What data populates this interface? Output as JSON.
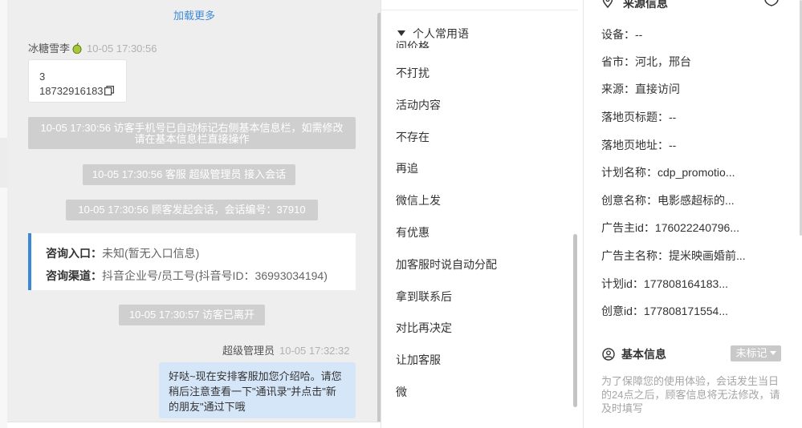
{
  "chat": {
    "load_more": "加载更多",
    "customer": {
      "name": "冰糖雪李",
      "time": "10-05 17:30:56"
    },
    "customer_msg": {
      "line1": "3",
      "line2": "18732916183"
    },
    "sys_messages": [
      "10-05 17:30:56 访客手机号已自动标记右侧基本信息栏，如需修改请在基本信息栏直接操作",
      "10-05 17:30:56 客服 超级管理员 接入会话",
      "10-05 17:30:56 顾客发起会话，会话编号：37910"
    ],
    "consult": {
      "entry_label": "咨询入口：",
      "entry_value": "未知(暂无入口信息)",
      "channel_label": "咨询渠道：",
      "channel_value": "抖音企业号/员工号(抖音号ID：36993034194)"
    },
    "left_msg": "10-05 17:30:57 访客已离开",
    "agent": {
      "name": "超级管理员",
      "time": "10-05 17:32:32"
    },
    "agent_msg": "好哒~现在安排客服加您介绍哈。请您稍后注意查看一下\"通讯录\"并点击\"新的朋友\"通过下哦"
  },
  "phrases": {
    "header": "个人常用语",
    "clipped_item": "问价格",
    "items": [
      "不打扰",
      "活动内容",
      "不存在",
      "再追",
      "微信上发",
      "有优惠",
      "加客服时说自动分配",
      "拿到联系后",
      "对比再决定",
      "让加客服",
      "微"
    ]
  },
  "info": {
    "source_title": "来源信息",
    "fields": [
      {
        "label": "设备：",
        "value": "--"
      },
      {
        "label": "省市：",
        "value": "河北，邢台"
      },
      {
        "label": "来源：",
        "value": "直接访问"
      },
      {
        "label": "落地页标题：",
        "value": "--"
      },
      {
        "label": "落地页地址：",
        "value": "--"
      },
      {
        "label": "计划名称：",
        "value": "cdp_promotio..."
      },
      {
        "label": "创意名称：",
        "value": "电影感超标的..."
      },
      {
        "label": "广告主id：",
        "value": "176022240796..."
      },
      {
        "label": "广告主名称：",
        "value": "提米映画婚前..."
      },
      {
        "label": "计划id：",
        "value": "177808164183..."
      },
      {
        "label": "创意id：",
        "value": "177808171554..."
      }
    ],
    "basic_title": "基本信息",
    "tag_label": "未标记",
    "notice": "为了保障您的使用体验，会话发生当日的24点之后，顾客信息将无法修改，请及时填写"
  },
  "colors": {
    "accent_blue": "#3b89d6",
    "sys_bubble": "#cfcfcf",
    "agent_bubble": "#d6e6f9"
  }
}
